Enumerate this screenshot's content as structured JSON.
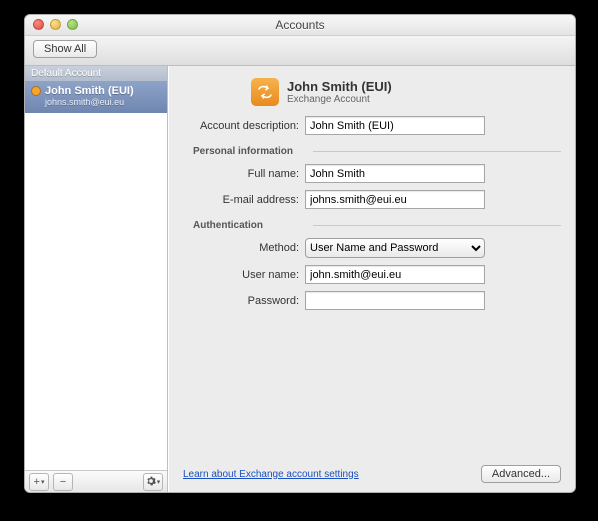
{
  "window": {
    "title": "Accounts"
  },
  "toolbar": {
    "show_all": "Show All"
  },
  "sidebar": {
    "section": "Default Account",
    "account": {
      "name": "John Smith (EUI)",
      "email": "johns.smith@eui.eu"
    }
  },
  "main": {
    "name": "John Smith (EUI)",
    "type": "Exchange Account"
  },
  "sections": {
    "personal": "Personal information",
    "auth": "Authentication"
  },
  "labels": {
    "description": "Account description:",
    "fullname": "Full name:",
    "email": "E-mail address:",
    "method": "Method:",
    "username": "User name:",
    "password": "Password:"
  },
  "values": {
    "description": "John Smith (EUI)",
    "fullname": "John Smith",
    "email": "johns.smith@eui.eu",
    "method": "User Name and Password",
    "username": "john.smith@eui.eu",
    "password": ""
  },
  "footer": {
    "learn": "Learn about Exchange account settings",
    "advanced": "Advanced..."
  }
}
